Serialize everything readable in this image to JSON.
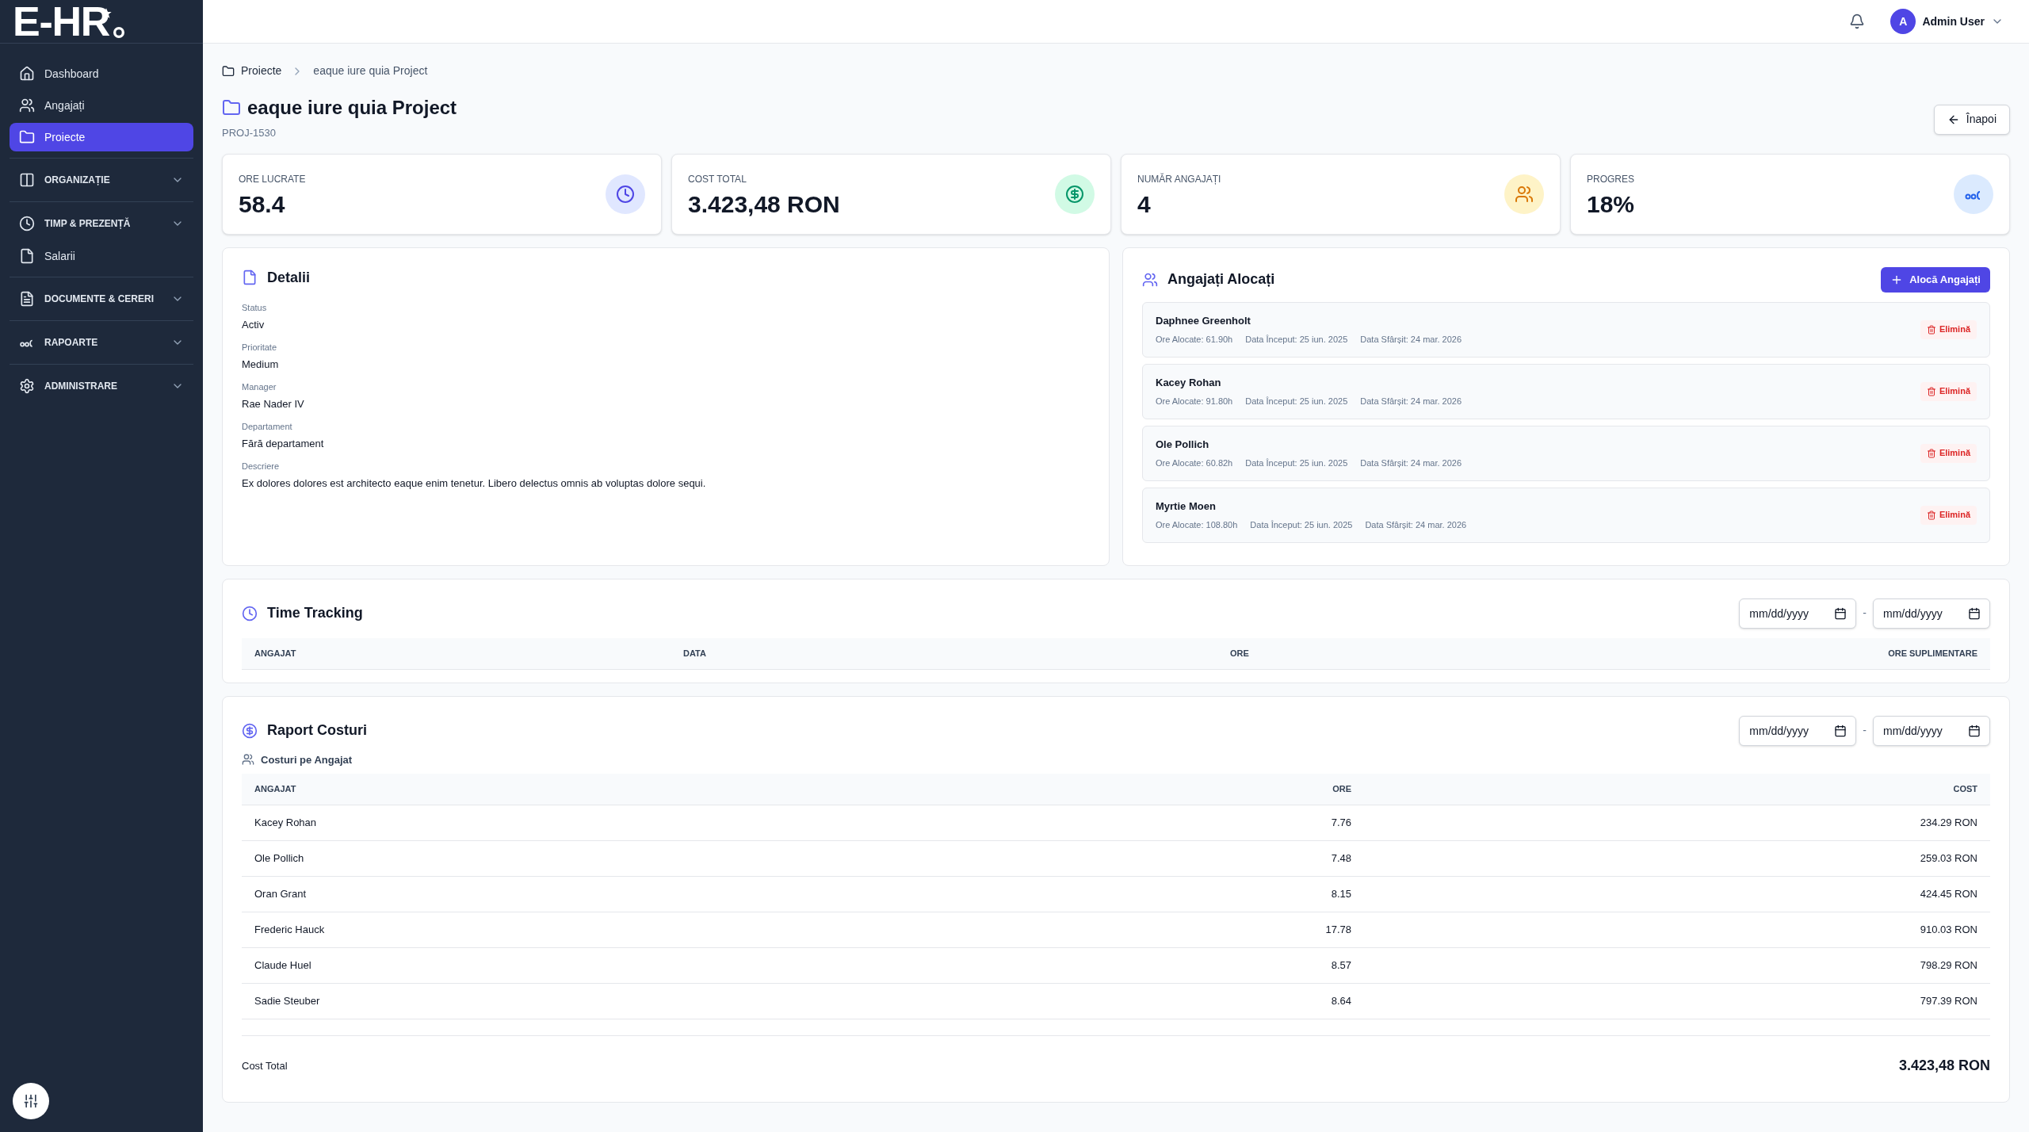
{
  "logo": {
    "text": "E-HR"
  },
  "sidebar": {
    "items": [
      {
        "kind": "link",
        "label": "Dashboard",
        "selected": false
      },
      {
        "kind": "link",
        "label": "Angajați",
        "selected": false
      },
      {
        "kind": "link",
        "label": "Proiecte",
        "selected": true
      },
      {
        "kind": "section",
        "label": "ORGANIZAȚIE"
      },
      {
        "kind": "section",
        "label": "TIMP & PREZENȚĂ"
      },
      {
        "kind": "link",
        "label": "Salarii",
        "selected": false
      },
      {
        "kind": "section",
        "label": "DOCUMENTE & CERERI"
      },
      {
        "kind": "section",
        "label": "RAPOARTE"
      },
      {
        "kind": "section",
        "label": "ADMINISTRARE"
      }
    ]
  },
  "header": {
    "user": {
      "initial": "A",
      "name": "Admin User"
    }
  },
  "breadcrumb": [
    "Proiecte",
    "eaque iure quia Project"
  ],
  "project": {
    "title": "eaque iure quia Project",
    "code": "PROJ-1530",
    "back_button": "Înapoi"
  },
  "stats": [
    {
      "kind": "clock",
      "label": "ORE LUCRATE",
      "value": "58.4"
    },
    {
      "kind": "money",
      "label": "COST TOTAL",
      "value": "3.423,48 RON"
    },
    {
      "kind": "people",
      "label": "NUMĂR ANGAJAȚI",
      "value": "4"
    },
    {
      "kind": "rings",
      "label": "PROGRES",
      "value": "18%"
    }
  ],
  "details": {
    "title": "Detalii",
    "fields": [
      {
        "label": "Status",
        "value": "Activ"
      },
      {
        "label": "Prioritate",
        "value": "Medium"
      },
      {
        "label": "Manager",
        "value": "Rae Nader IV"
      },
      {
        "label": "Departament",
        "value": "Fără departament"
      },
      {
        "label": "Descriere",
        "value": "Ex dolores dolores est architecto eaque enim tenetur. Libero delectus omnis ab voluptas dolore sequi."
      }
    ]
  },
  "allocated": {
    "title": "Angajați Alocați",
    "button": "Alocă Angajați",
    "employees": [
      {
        "name": "Daphnee Greenholt",
        "hours": "Ore Alocate: 61.90h",
        "start": "Data Început: 25 iun. 2025",
        "end": "Data Sfârșit: 24 mar. 2026",
        "remove": "Elimină"
      },
      {
        "name": "Kacey Rohan",
        "hours": "Ore Alocate: 91.80h",
        "start": "Data Început: 25 iun. 2025",
        "end": "Data Sfârșit: 24 mar. 2026",
        "remove": "Elimină"
      },
      {
        "name": "Ole Pollich",
        "hours": "Ore Alocate: 60.82h",
        "start": "Data Început: 25 iun. 2025",
        "end": "Data Sfârșit: 24 mar. 2026",
        "remove": "Elimină"
      },
      {
        "name": "Myrtie Moen",
        "hours": "Ore Alocate: 108.80h",
        "start": "Data Început: 25 iun. 2025",
        "end": "Data Sfârșit: 24 mar. 2026",
        "remove": "Elimină"
      }
    ]
  },
  "time_tracking": {
    "title": "Time Tracking",
    "date_from": {
      "placeholder": "mm/dd/yyyy"
    },
    "separator": "-",
    "date_to": {
      "placeholder": "mm/dd/yyyy"
    },
    "columns": [
      "ANGAJAT",
      "DATA",
      "ORE",
      "ORE SUPLIMENTARE"
    ]
  },
  "cost_report": {
    "title": "Raport Costuri",
    "date_from": {
      "placeholder": "mm/dd/yyyy"
    },
    "separator": "-",
    "date_to": {
      "placeholder": "mm/dd/yyyy"
    },
    "subtitle": "Costuri pe Angajat",
    "columns": [
      "ANGAJAT",
      "ORE",
      "COST"
    ],
    "rows": [
      [
        "Kacey Rohan",
        "7.76",
        "234.29 RON"
      ],
      [
        "Ole Pollich",
        "7.48",
        "259.03 RON"
      ],
      [
        "Oran Grant",
        "8.15",
        "424.45 RON"
      ],
      [
        "Frederic Hauck",
        "17.78",
        "910.03 RON"
      ],
      [
        "Claude Huel",
        "8.57",
        "798.29 RON"
      ],
      [
        "Sadie Steuber",
        "8.64",
        "797.39 RON"
      ]
    ],
    "total_label": "Cost Total",
    "total_value": "3.423,48 RON"
  }
}
